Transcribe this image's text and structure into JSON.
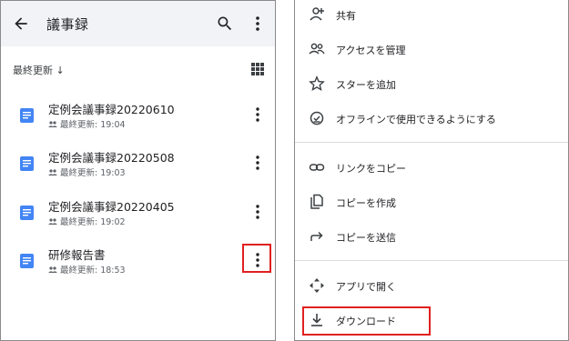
{
  "app": {
    "title": "議事録",
    "sort_label": "最終更新 ↓"
  },
  "files": [
    {
      "name": "定例会議事録20220610",
      "meta": "最終更新: 19:04"
    },
    {
      "name": "定例会議事録20220508",
      "meta": "最終更新: 19:03"
    },
    {
      "name": "定例会議事録20220405",
      "meta": "最終更新: 19:02"
    },
    {
      "name": "研修報告書",
      "meta": "最終更新: 18:53"
    }
  ],
  "menu": {
    "items": [
      {
        "label": "共有",
        "icon": "add-person-icon"
      },
      {
        "label": "アクセスを管理",
        "icon": "people-icon"
      },
      {
        "label": "スターを追加",
        "icon": "star-icon"
      },
      {
        "label": "オフラインで使用できるようにする",
        "icon": "offline-icon"
      },
      {
        "label": "リンクをコピー",
        "icon": "link-icon"
      },
      {
        "label": "コピーを作成",
        "icon": "copy-icon"
      },
      {
        "label": "コピーを送信",
        "icon": "send-icon"
      },
      {
        "label": "アプリで開く",
        "icon": "open-with-icon"
      },
      {
        "label": "ダウンロード",
        "icon": "download-icon"
      }
    ]
  },
  "colors": {
    "doc_blue": "#4285f4",
    "highlight_red": "#e0201f",
    "appbar_bg": "#f1f3f6"
  }
}
